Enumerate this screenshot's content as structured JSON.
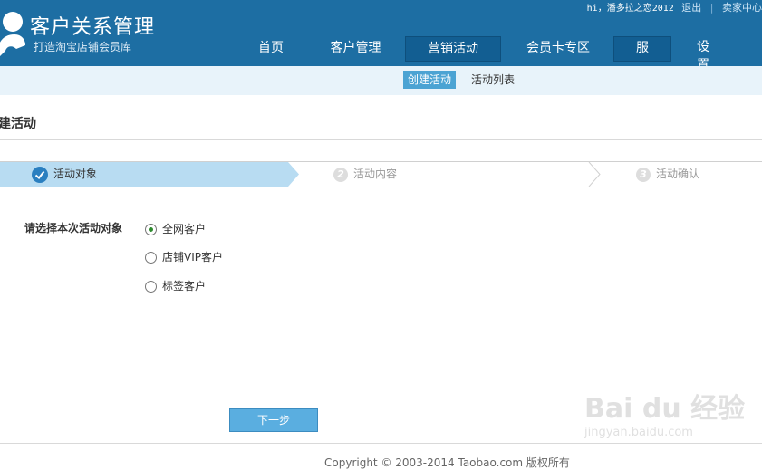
{
  "header": {
    "title": "客户关系管理",
    "subtitle": "打造淘宝店铺会员库",
    "greeting": "hi，潘多拉之恋2012",
    "logout": "退出",
    "seller_center": "卖家中心"
  },
  "nav": {
    "items": [
      "首页",
      "客户管理",
      "营销活动",
      "会员卡专区",
      "服务",
      "设置"
    ],
    "active_index": 2
  },
  "subnav": {
    "items": [
      "创建活动",
      "活动列表"
    ],
    "active_index": 0
  },
  "page": {
    "title": "建活动"
  },
  "steps": [
    {
      "num": "",
      "label": "活动对象",
      "state": "done"
    },
    {
      "num": "2",
      "label": "活动内容",
      "state": "todo"
    },
    {
      "num": "3",
      "label": "活动确认",
      "state": "todo"
    }
  ],
  "form": {
    "label": "请选择本次活动对象",
    "options": [
      "全网客户",
      "店铺VIP客户",
      "标签客户"
    ],
    "selected_index": 0
  },
  "buttons": {
    "next": "下一步"
  },
  "footer": {
    "copyright": "Copyright © 2003-2014 Taobao.com 版权所有"
  },
  "watermark": {
    "brand": "Bai du 经验",
    "url": "jingyan.baidu.com"
  },
  "colors": {
    "header_bg": "#1d6ea3",
    "nav_active": "#125e92",
    "subnav_bg": "#e8f3fa",
    "step_active_bg": "#b8dcf2",
    "button_bg": "#5aaee0"
  }
}
